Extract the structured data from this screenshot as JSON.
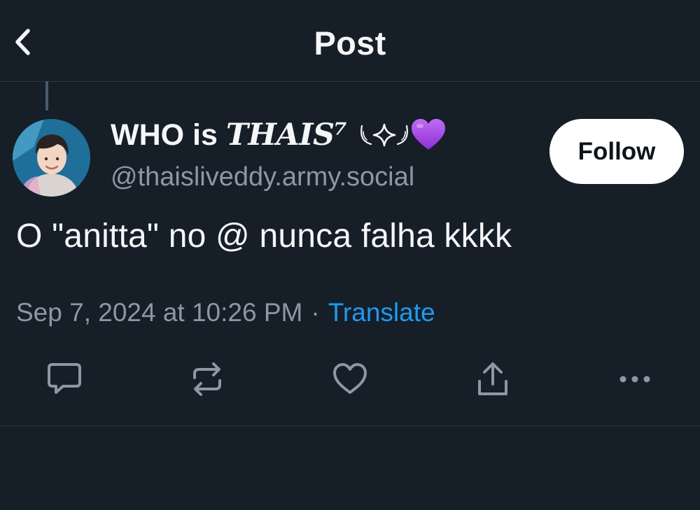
{
  "header": {
    "title": "Post",
    "back_icon": "chevron-left-icon"
  },
  "post": {
    "author": {
      "display_name": "WHO is",
      "display_name_stylized": "THAIS⁷",
      "name_emojis": [
        "wing-left-icon",
        "sparkle-icon",
        "wing-right-icon",
        "purple-heart-icon"
      ],
      "handle": "@thaisliveddy.army.social",
      "follow_label": "Follow"
    },
    "text": "O \"anitta\" no @ nunca falha kkkk",
    "timestamp": "Sep 7, 2024 at 10:26 PM",
    "separator": "·",
    "translate_label": "Translate"
  },
  "actions": {
    "items": [
      "reply-icon",
      "repost-icon",
      "like-icon",
      "share-icon",
      "more-icon"
    ]
  },
  "colors": {
    "background": "#161e27",
    "divider": "#2c3844",
    "secondary_text": "#8b98a5",
    "link": "#1d9bf0",
    "heart": "#a855f7"
  }
}
